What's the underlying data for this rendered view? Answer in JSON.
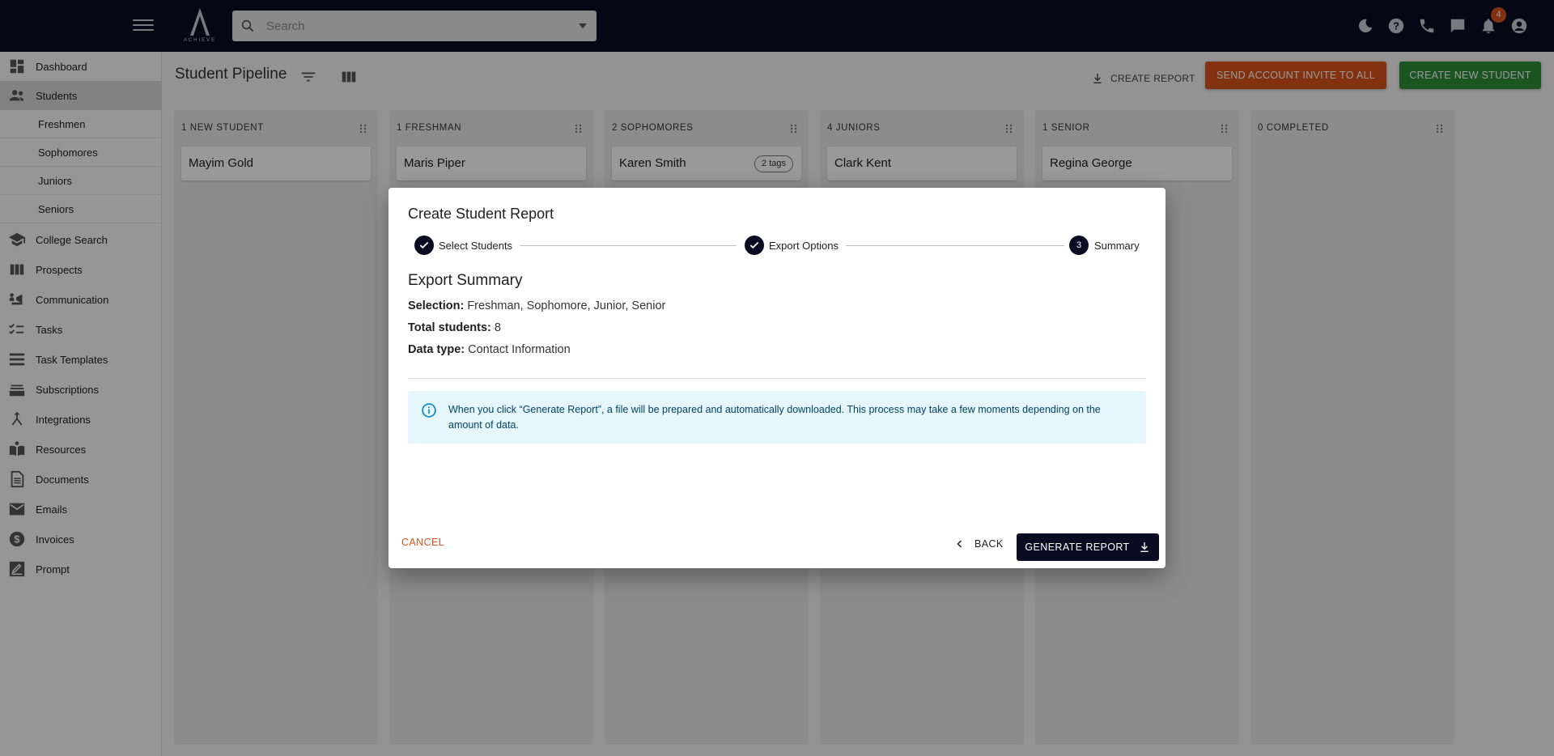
{
  "topbar": {
    "logo_text": "ACHIEVE",
    "search_placeholder": "Search",
    "notification_count": "4"
  },
  "sidebar": {
    "items": [
      {
        "label": "Dashboard",
        "icon": "dashboard-icon"
      },
      {
        "label": "Students",
        "icon": "people-icon",
        "active": true
      },
      {
        "label": "College Search",
        "icon": "school-icon"
      },
      {
        "label": "Prospects",
        "icon": "view-columns-icon"
      },
      {
        "label": "Communication",
        "icon": "communication-icon"
      },
      {
        "label": "Tasks",
        "icon": "checklist-icon"
      },
      {
        "label": "Task Templates",
        "icon": "list-icon"
      },
      {
        "label": "Subscriptions",
        "icon": "stack-icon"
      },
      {
        "label": "Integrations",
        "icon": "merge-icon"
      },
      {
        "label": "Resources",
        "icon": "book-icon"
      },
      {
        "label": "Documents",
        "icon": "document-icon"
      },
      {
        "label": "Emails",
        "icon": "email-icon"
      },
      {
        "label": "Invoices",
        "icon": "dollar-icon"
      },
      {
        "label": "Prompt",
        "icon": "prompt-icon"
      }
    ],
    "sub_items": [
      "Freshmen",
      "Sophomores",
      "Juniors",
      "Seniors"
    ]
  },
  "main": {
    "title": "Student Pipeline",
    "create_report_label": "CREATE REPORT",
    "invite_label": "SEND ACCOUNT INVITE TO ALL",
    "create_student_label": "CREATE NEW STUDENT",
    "columns": [
      {
        "header": "1 NEW STUDENT",
        "cards": [
          {
            "name": "Mayim Gold"
          }
        ]
      },
      {
        "header": "1 FRESHMAN",
        "cards": [
          {
            "name": "Maris Piper"
          }
        ]
      },
      {
        "header": "2 SOPHOMORES",
        "cards": [
          {
            "name": "Karen Smith",
            "tag": "2 tags"
          }
        ]
      },
      {
        "header": "4 JUNIORS",
        "cards": [
          {
            "name": "Clark Kent"
          }
        ]
      },
      {
        "header": "1 SENIOR",
        "cards": [
          {
            "name": "Regina George"
          }
        ]
      },
      {
        "header": "0 COMPLETED",
        "cards": []
      }
    ]
  },
  "dialog": {
    "title": "Create Student Report",
    "steps": [
      {
        "label": "Select Students",
        "state": "complete"
      },
      {
        "label": "Export Options",
        "state": "complete"
      },
      {
        "number": "3",
        "label": "Summary",
        "state": "active"
      }
    ],
    "summary_title": "Export Summary",
    "selection_label": "Selection:",
    "selection_value": "Freshman, Sophomore, Junior, Senior",
    "total_label": "Total students:",
    "total_value": "8",
    "datatype_label": "Data type:",
    "datatype_value": "Contact Information",
    "info_text": "When you click “Generate Report”, a file will be prepared and automatically downloaded. This process may take a few moments depending on the amount of data.",
    "cancel_label": "CANCEL",
    "back_label": "BACK",
    "generate_label": "GENERATE REPORT"
  },
  "colors": {
    "topbar": "#0a0c22",
    "accent_orange": "#d9541d",
    "accent_green": "#2e8f3a",
    "info_bg": "#e5f6fd"
  }
}
